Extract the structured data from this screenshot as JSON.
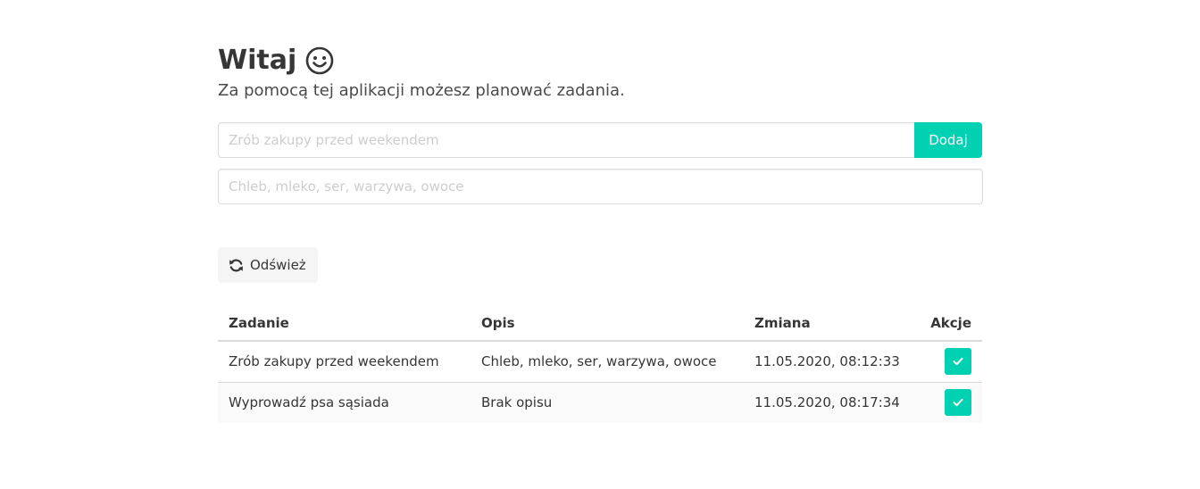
{
  "header": {
    "title": "Witaj",
    "subtitle": "Za pomocą tej aplikacji możesz planować zadania."
  },
  "form": {
    "task_placeholder": "Zrób zakupy przed weekendem",
    "task_value": "",
    "add_label": "Dodaj",
    "description_placeholder": "Chleb, mleko, ser, warzywa, owoce",
    "description_value": ""
  },
  "toolbar": {
    "refresh_label": "Odśwież",
    "refresh_icon": "refresh-icon"
  },
  "table": {
    "columns": [
      "Zadanie",
      "Opis",
      "Zmiana",
      "Akcje"
    ],
    "rows": [
      {
        "task": "Zrób zakupy przed weekendem",
        "description": "Chleb, mleko, ser, warzywa, owoce",
        "changed": "11.05.2020, 08:12:33",
        "action_icon": "check-icon"
      },
      {
        "task": "Wyprowadź psa sąsiada",
        "description": "Brak opisu",
        "changed": "11.05.2020, 08:17:34",
        "action_icon": "check-icon"
      }
    ]
  },
  "colors": {
    "primary": "#00d1b2",
    "text": "#363636",
    "light_button": "#f5f5f5",
    "border": "#dbdbdb"
  }
}
